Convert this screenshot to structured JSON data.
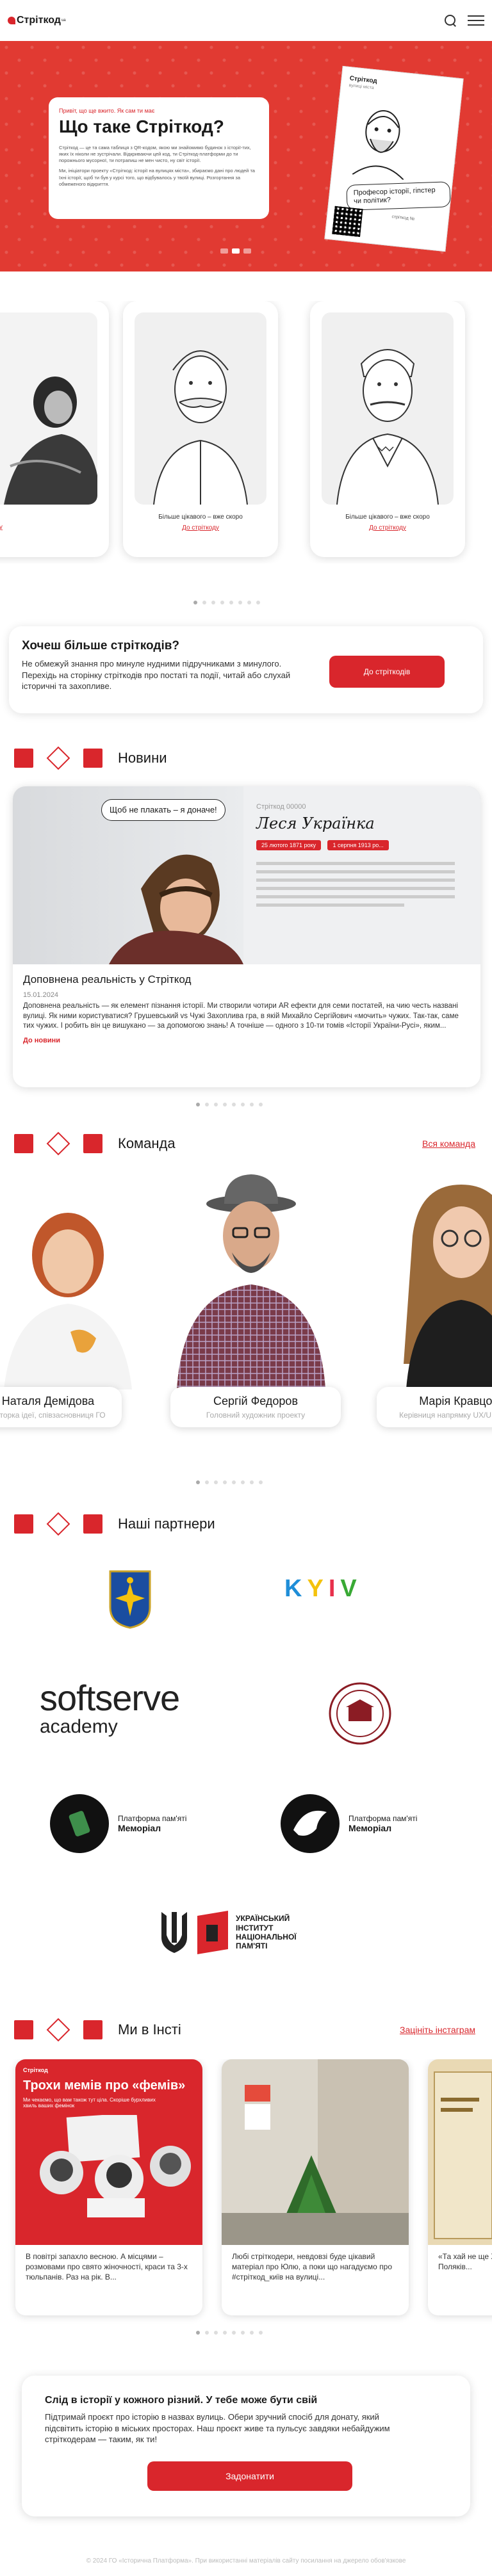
{
  "header": {
    "logo": "Стріткод",
    "logo_sup": "ua"
  },
  "hero": {
    "kicker": "Привіт, що ще вжито. Як сам ти має",
    "title": "Що таке Стріткод?",
    "text1": "Стріткод — це та сама таблиця з QR-кодом, якою ми знайомимо будинок з історії-тих, яких їх ніколи не зустрічали. Відкриваючи цей код, ти Стріткод-платформи до ти порожнього мусорної, ти потрапиш не мен чисто, ну світ історії.",
    "text2": "Ми, ініціатори проекту «Стріткод: історії на вулицях міста», збираємо дані про людей та їхні історії, щоб ти був у курсі того, що відбувалось у твоїй вулиці. Розгортання за обмеженого відкриття.",
    "poster_logo": "Стріткод",
    "poster_sub": "вулиці міста",
    "poster_bubble": "Професор історії, гіпстер чи політик?",
    "poster_num": "стріткод №",
    "slides": 3,
    "active_slide": 2
  },
  "characters": [
    {
      "caption": "",
      "link": "До стріткоду"
    },
    {
      "caption": "Більше цікавого – вже скоро",
      "link": "До стріткоду"
    },
    {
      "caption": "Більше цікавого – вже скоро",
      "link": "До стріткоду"
    }
  ],
  "char_dots": {
    "count": 8,
    "active": 0
  },
  "cta_stritkod": {
    "title": "Хочеш більше стріткодів?",
    "text": "Не обмежуй знання про минуле нудними підручниками з минулого. Перехідь на сторінку стріткодів про постаті та події, читай або слухай історичні та захопливе.",
    "button": "До стріткодів"
  },
  "news_section": {
    "title": "Новини",
    "item": {
      "board_label": "Стріткод 00000",
      "board_title": "Леся Українка",
      "board_pill1": "25 лютого 1871 року",
      "board_pill2": "1 серпня 1913 ро...",
      "bubble": "Щоб не плакать – я доначе!",
      "title": "Доповнена реальність у Стріткод",
      "date": "15.01.2024",
      "text": "Доповнена реальність — як елемент пізнання історії. Ми створили чотири AR ефекти для семи постатей, на чию честь названі вулиці. Як ними користуватися? Грушевський vs Чужі Захоплива гра, в якій Михайло Сергійович «мочить» чужих. Так-так, саме тих чужих. І робить він це вишукано — за допомогою знань! А точніше — одного з 10-ти томів «Історії України-Русі», яким...",
      "more": "До новини"
    },
    "dots": {
      "count": 8,
      "active": 0
    }
  },
  "team_section": {
    "title": "Команда",
    "link": "Вся команда",
    "members": [
      {
        "name": "Наталя Демідова",
        "role": "Авторка ідеї, співзасновниця ГО"
      },
      {
        "name": "Сергій Федоров",
        "role": "Головний художник проекту"
      },
      {
        "name": "Марія Кравцова",
        "role": "Керівниця напрямку UX/UI дизайну"
      }
    ],
    "dots": {
      "count": 8,
      "active": 0
    }
  },
  "partners_section": {
    "title": "Наші партнери",
    "kyiv_logo": "KYIV",
    "kyiv_colors": [
      "#1f8ed8",
      "#f4c20d",
      "#e8304b",
      "#39a935"
    ],
    "softserve_line1": "softserve",
    "softserve_line2": "academy",
    "memorial1_line1": "Платформа пам'яті",
    "memorial1_line2": "Меморіал",
    "memorial2_line1": "Платформа пам'яті",
    "memorial2_line2": "Меморіал",
    "uinp_line1": "УКРАЇНСЬКИЙ",
    "uinp_line2": "ІНСТИТУТ",
    "uinp_line3": "НАЦІОНАЛЬНОЇ",
    "uinp_line4": "ПАМ'ЯТІ"
  },
  "insta_section": {
    "title": "Ми в Інсті",
    "link": "Зацініть інстаграм",
    "posts": [
      {
        "badge": "Стріткод",
        "img_title": "Трохи мемів про «фемів»",
        "img_sub": "Ми чекаємо, що вам також тут ціла. Скоріше бурхливих хвиль ваших фемінок",
        "text": "В повітрі запахло весною. А місцями – розмовами про свято жіночності, краси та 3-х тюльпанів. Раз на рік. В..."
      },
      {
        "badge": "",
        "img_title": "",
        "img_sub": "",
        "text": "Любі стріткодери, невдовзі буде цікавий матеріал про Юлю, а поки що нагадуємо про #стріткод_київ на вулиці..."
      },
      {
        "badge": "",
        "img_title": "",
        "img_sub": "",
        "text": "«Та хай не ще Хмельницьк ребе, щоб н Поляків..."
      }
    ],
    "dots": {
      "count": 8,
      "active": 0
    }
  },
  "donate": {
    "title": "Слід в історії у кожного різний. У тебе може бути свій",
    "text": "Підтримай проєкт про історію в назвах вулиць. Обери зручний спосіб для донату, який підсвітить історію в міських просторах. Наш проєкт живе та пульсує завдяки небайдужим стріткодерам — таким, як ти!",
    "button": "Задонатити"
  },
  "footer": {
    "text": "© 2024 ГО «Історична Платформа». При використанні матеріалів сайту посилання на джерело обов'язкове"
  },
  "colors": {
    "brand": "#d9262c",
    "hero_bg": "#e13a32"
  }
}
